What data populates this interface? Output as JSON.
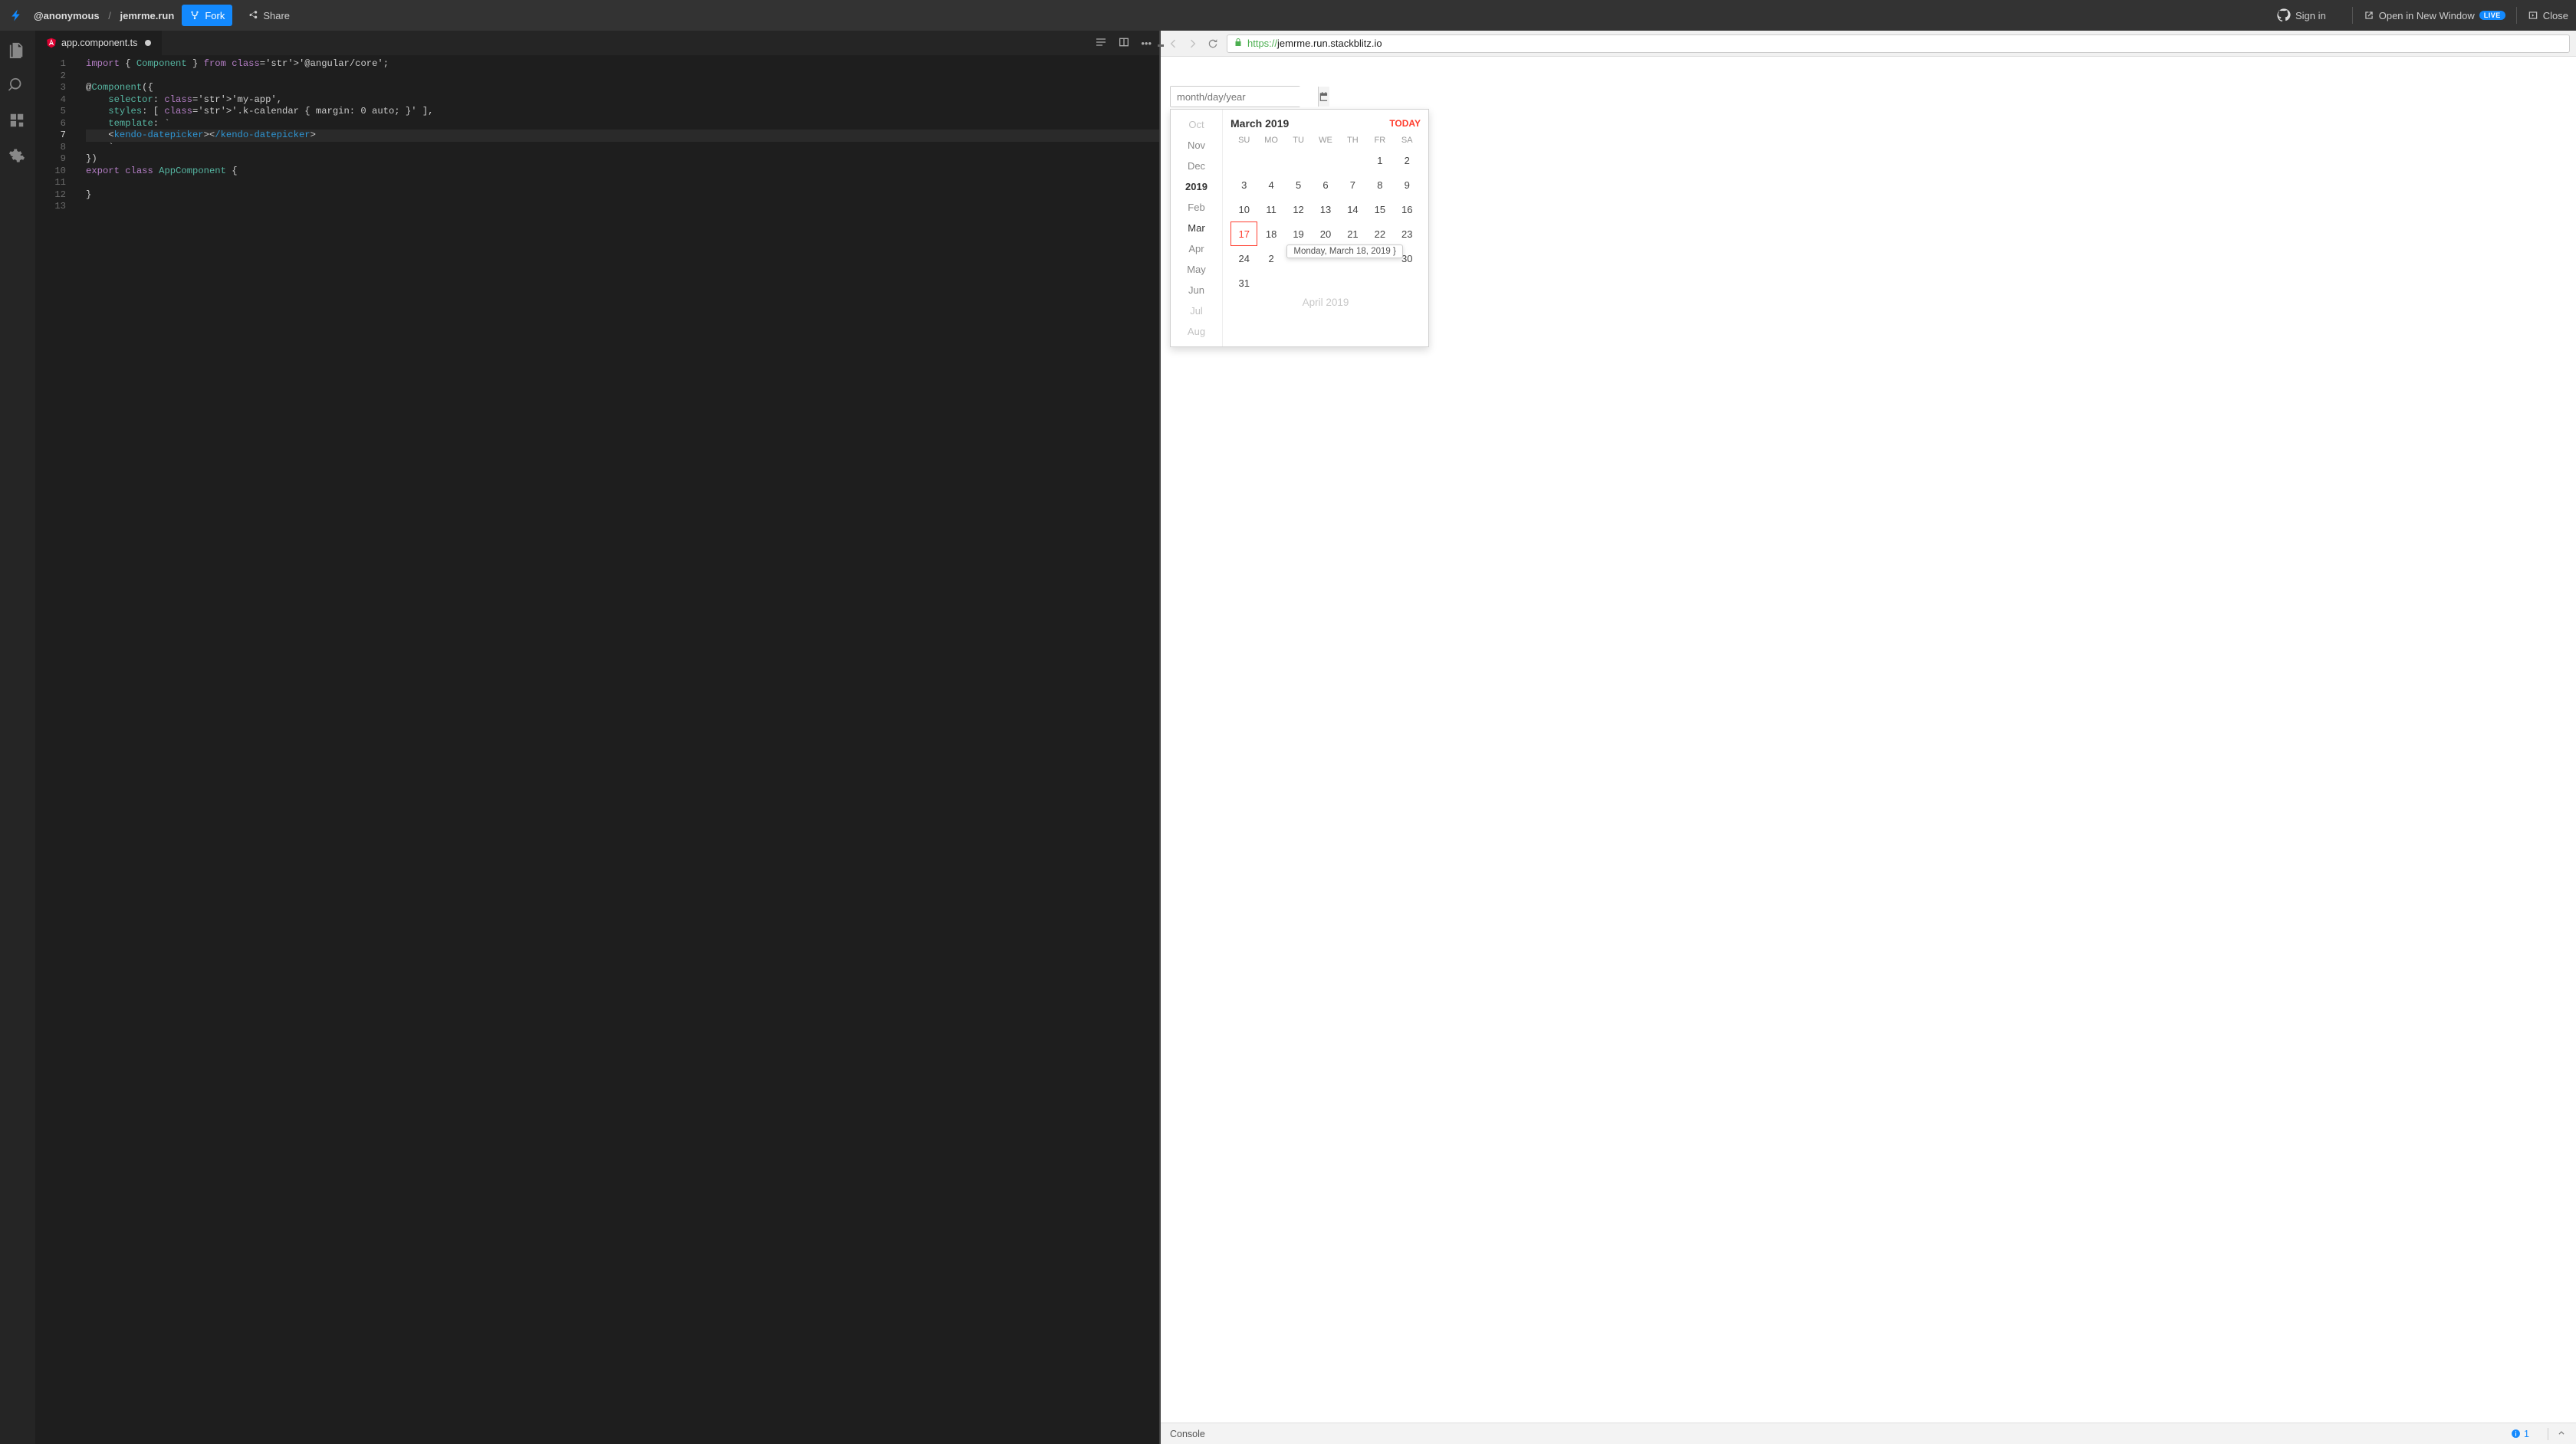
{
  "topbar": {
    "owner": "@anonymous",
    "project": "jemrme.run",
    "fork": "Fork",
    "share": "Share",
    "signin": "Sign in",
    "newwin": "Open in New Window",
    "live": "LIVE",
    "close": "Close"
  },
  "tab": {
    "filename": "app.component.ts"
  },
  "code": {
    "lines": [
      "import { Component } from '@angular/core';",
      "",
      "@Component({",
      "    selector: 'my-app',",
      "    styles: [ '.k-calendar { margin: 0 auto; }' ],",
      "    template: `",
      "    <kendo-datepicker></kendo-datepicker>",
      "    `",
      "})",
      "export class AppComponent {",
      "",
      "}",
      ""
    ]
  },
  "preview": {
    "url_proto": "https://",
    "url_rest": "jemrme.run.stackblitz.io",
    "placeholder": "month/day/year"
  },
  "calendar": {
    "strip": [
      "Oct",
      "Nov",
      "Dec",
      "2019",
      "Feb",
      "Mar",
      "Apr",
      "May",
      "Jun",
      "Jul",
      "Aug"
    ],
    "title": "March 2019",
    "today_label": "TODAY",
    "dow": [
      "SU",
      "MO",
      "TU",
      "WE",
      "TH",
      "FR",
      "SA"
    ],
    "weeks": [
      [
        "",
        "",
        "",
        "",
        "",
        "1",
        "2"
      ],
      [
        "3",
        "4",
        "5",
        "6",
        "7",
        "8",
        "9"
      ],
      [
        "10",
        "11",
        "12",
        "13",
        "14",
        "15",
        "16"
      ],
      [
        "17",
        "18",
        "19",
        "20",
        "21",
        "22",
        "23"
      ],
      [
        "24",
        "2",
        "",
        "",
        "",
        "",
        "30"
      ],
      [
        "31",
        "",
        "",
        "",
        "",
        "",
        ""
      ]
    ],
    "today_cell": "17",
    "tooltip": "Monday, March 18, 2019",
    "next_month": "April 2019"
  },
  "console": {
    "label": "Console",
    "info_count": "1"
  }
}
